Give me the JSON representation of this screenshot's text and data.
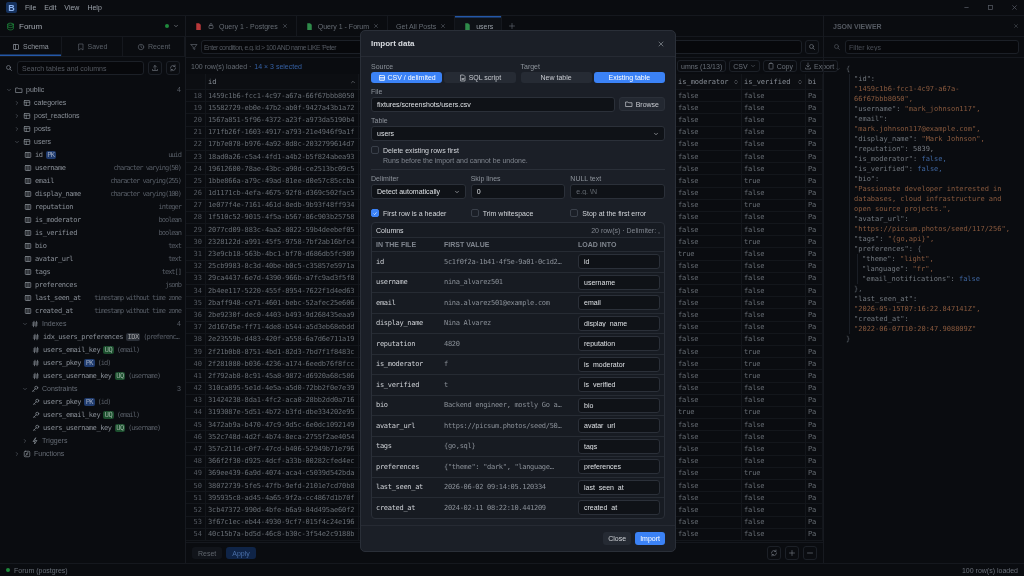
{
  "menubar": {
    "logo": "B",
    "menus": [
      "File",
      "Edit",
      "View",
      "Help"
    ]
  },
  "sidebar": {
    "connection": {
      "name": "Forum",
      "connected": true
    },
    "tabs": [
      {
        "label": "Schema",
        "selected": true
      },
      {
        "label": "Saved",
        "selected": false
      },
      {
        "label": "Recent",
        "selected": false
      }
    ],
    "search": {
      "placeholder": "Search tables and columns"
    },
    "tree": [
      {
        "kind": "schema",
        "label": "public",
        "count": "4",
        "expanded": true,
        "children": [
          {
            "kind": "table",
            "label": "categories",
            "expanded": false
          },
          {
            "kind": "table",
            "label": "post_reactions",
            "expanded": false
          },
          {
            "kind": "table",
            "label": "posts",
            "expanded": false
          },
          {
            "kind": "table",
            "label": "users",
            "expanded": true,
            "children": [
              {
                "kind": "column",
                "label": "id",
                "badge": {
                  "text": "PK",
                  "color": "#1f3b6e"
                },
                "type": "uuid"
              },
              {
                "kind": "column",
                "label": "username",
                "type": "character varying(50)"
              },
              {
                "kind": "column",
                "label": "email",
                "type": "character varying(255)"
              },
              {
                "kind": "column",
                "label": "display_name",
                "type": "character varying(100)"
              },
              {
                "kind": "column",
                "label": "reputation",
                "type": "integer"
              },
              {
                "kind": "column",
                "label": "is_moderator",
                "type": "boolean"
              },
              {
                "kind": "column",
                "label": "is_verified",
                "type": "boolean"
              },
              {
                "kind": "column",
                "label": "bio",
                "type": "text"
              },
              {
                "kind": "column",
                "label": "avatar_url",
                "type": "text"
              },
              {
                "kind": "column",
                "label": "tags",
                "type": "text[]"
              },
              {
                "kind": "column",
                "label": "preferences",
                "type": "jsonb"
              },
              {
                "kind": "column",
                "label": "last_seen_at",
                "type": "timestamp without time zone"
              },
              {
                "kind": "column",
                "label": "created_at",
                "type": "timestamp without time zone"
              },
              {
                "kind": "indexes",
                "label": "Indexes",
                "count": "4",
                "expanded": true,
                "children": [
                  {
                    "kind": "index",
                    "label": "idx_users_preferences",
                    "badge": {
                      "text": "IDX",
                      "color": "#2b3038"
                    },
                    "detail": "(preferenc…"
                  },
                  {
                    "kind": "index",
                    "label": "users_email_key",
                    "badge": {
                      "text": "UQ",
                      "color": "#1c4f2e"
                    },
                    "detail": "(email)"
                  },
                  {
                    "kind": "index",
                    "label": "users_pkey",
                    "badge": {
                      "text": "PK",
                      "color": "#1f3b6e"
                    },
                    "detail": "(id)"
                  },
                  {
                    "kind": "index",
                    "label": "users_username_key",
                    "badge": {
                      "text": "UQ",
                      "color": "#1c4f2e"
                    },
                    "detail": "(username)"
                  }
                ]
              },
              {
                "kind": "constraints",
                "label": "Constraints",
                "count": "3",
                "expanded": true,
                "children": [
                  {
                    "kind": "constraint",
                    "label": "users_pkey",
                    "badge": {
                      "text": "PK",
                      "color": "#1f3b6e"
                    },
                    "detail": "(id)"
                  },
                  {
                    "kind": "constraint",
                    "label": "users_email_key",
                    "badge": {
                      "text": "UQ",
                      "color": "#1c4f2e"
                    },
                    "detail": "(email)"
                  },
                  {
                    "kind": "constraint",
                    "label": "users_username_key",
                    "badge": {
                      "text": "UQ",
                      "color": "#1c4f2e"
                    },
                    "detail": "(username)"
                  }
                ]
              },
              {
                "kind": "triggers",
                "label": "Triggers",
                "expanded": false
              }
            ]
          },
          {
            "kind": "functions",
            "label": "Functions",
            "expanded": false
          }
        ]
      }
    ]
  },
  "editor_tabs": [
    {
      "label": "Query 1 - Postgres",
      "color": "#b8383a",
      "locked": true,
      "selected": false
    },
    {
      "label": "Query 1 - Forum",
      "color": "#2f8a4a",
      "selected": false
    },
    {
      "label": "Get All Posts",
      "selected": false
    },
    {
      "label": "users",
      "color": "#2f8a4a",
      "selected": true
    }
  ],
  "filter": {
    "placeholder": "Enter condition, e.g. id > 100 AND name LIKE 'Peter"
  },
  "result_status": {
    "loaded": "100 row(s) loaded ·",
    "selection": "14 × 3 selected"
  },
  "result_toolbar": [
    {
      "label": "umns (13/13)"
    },
    {
      "label": "CSV",
      "dropdown": true
    },
    {
      "label": "Copy"
    },
    {
      "label": "Export"
    }
  ],
  "table": {
    "columns": [
      {
        "label": "id",
        "sorted": true
      },
      {
        "label": "is_moderator",
        "sorted": false
      },
      {
        "label": "is_verified",
        "sorted": false
      },
      {
        "label": "bi"
      }
    ],
    "rows": [
      {
        "num": "18",
        "cells": [
          "1459c1b6-fcc1-4c97-a67a-66f67bbb8050",
          "false",
          "false",
          "Pa"
        ]
      },
      {
        "num": "19",
        "cells": [
          "15582729-eb0e-47b2-ab0f-9427a43b1a72",
          "false",
          "false",
          "Pa"
        ]
      },
      {
        "num": "20",
        "cells": [
          "1567a851-5f96-4372-a23f-a973da5190b4",
          "false",
          "false",
          "Pa"
        ]
      },
      {
        "num": "21",
        "cells": [
          "171fb26f-1603-4917-a793-21e4946f9a1f",
          "false",
          "false",
          "Pa"
        ]
      },
      {
        "num": "22",
        "cells": [
          "17b7e078-b976-4a92-8d8c-2032799614d7",
          "false",
          "false",
          "Pa"
        ]
      },
      {
        "num": "23",
        "cells": [
          "18ad0a26-c5a4-4fd1-a4b2-b5f824abea93",
          "false",
          "false",
          "Pa"
        ]
      },
      {
        "num": "24",
        "cells": [
          "19612600-78ae-43bc-a90d-ce2513bc09c5",
          "false",
          "false",
          "Pa"
        ]
      },
      {
        "num": "25",
        "cells": [
          "1bbe866a-a79c-49ad-81ee-d0e57c85ccba",
          "false",
          "true",
          "Pa"
        ]
      },
      {
        "num": "26",
        "cells": [
          "1d1171cb-4efa-4675-92f8-d369c502fac5",
          "false",
          "false",
          "Pa"
        ]
      },
      {
        "num": "27",
        "cells": [
          "1e077f4e-7161-461d-8edb-9b93f48ff934",
          "false",
          "true",
          "Pa"
        ]
      },
      {
        "num": "28",
        "cells": [
          "1f510c52-9015-4f5a-b567-86c903b25758",
          "false",
          "false",
          "Pa"
        ]
      },
      {
        "num": "29",
        "cells": [
          "2077cd09-883c-4aa2-8022-59b4deebef05",
          "false",
          "false",
          "Pa"
        ]
      },
      {
        "num": "30",
        "cells": [
          "2328122d-a991-45f5-9758-7bf2ab16bfc4",
          "false",
          "true",
          "Pa"
        ]
      },
      {
        "num": "31",
        "cells": [
          "23e9cb18-563b-4bc1-bf70-d686db5fc989",
          "true",
          "false",
          "Pa"
        ]
      },
      {
        "num": "32",
        "cells": [
          "25cb9983-8c3d-40be-b0c5-c35857e5971a",
          "false",
          "false",
          "Pa"
        ]
      },
      {
        "num": "33",
        "cells": [
          "29ca4437-6e7d-4390-966b-a7fc9ad3f5f8",
          "false",
          "false",
          "Pa"
        ]
      },
      {
        "num": "34",
        "cells": [
          "2b4ee117-5220-455f-8954-7622f1d4ed63",
          "false",
          "false",
          "Pa"
        ]
      },
      {
        "num": "35",
        "cells": [
          "2baff948-ce71-4601-bebc-52afec25e606",
          "false",
          "false",
          "Pa"
        ]
      },
      {
        "num": "36",
        "cells": [
          "2be9230f-dec0-4403-b493-9d268435eaa9",
          "false",
          "false",
          "Pa"
        ]
      },
      {
        "num": "37",
        "cells": [
          "2d167d5e-ff71-4de8-b544-a5d3eb68ebdd",
          "false",
          "false",
          "Pa"
        ]
      },
      {
        "num": "38",
        "cells": [
          "2e23559b-d483-420f-a558-6a7d6e711a19",
          "false",
          "false",
          "Pa"
        ]
      },
      {
        "num": "39",
        "cells": [
          "2f21b0b8-8751-4bd1-82d3-7bd7f1f8483c",
          "false",
          "true",
          "Pa"
        ]
      },
      {
        "num": "40",
        "cells": [
          "2f281080-b036-4236-a174-6eedb76f8fcc",
          "false",
          "true",
          "Pa"
        ]
      },
      {
        "num": "41",
        "cells": [
          "2f792ab8-8c91-45a8-9872-d6920a68c586",
          "false",
          "true",
          "Pa"
        ]
      },
      {
        "num": "42",
        "cells": [
          "310ca895-5e1d-4e5a-a5d0-72bb2f0e7e39",
          "false",
          "false",
          "Pa"
        ]
      },
      {
        "num": "43",
        "cells": [
          "31424238-8da1-4fc2-aca0-28bb2dd0a716",
          "false",
          "false",
          "Pa"
        ]
      },
      {
        "num": "44",
        "cells": [
          "3193087e-5d51-4b72-b3fd-dbe334202e95",
          "true",
          "true",
          "Pa"
        ]
      },
      {
        "num": "45",
        "cells": [
          "3472ab9a-b470-47c9-9d5c-6e0dc1092149",
          "false",
          "false",
          "Pa"
        ]
      },
      {
        "num": "46",
        "cells": [
          "352c748d-4d2f-4b74-8eca-2755f2ae4054",
          "false",
          "false",
          "Pa"
        ]
      },
      {
        "num": "47",
        "cells": [
          "357c211d-c0f7-47cd-b406-52949b71e796",
          "false",
          "false",
          "Pa"
        ]
      },
      {
        "num": "48",
        "cells": [
          "366f2f30-d925-4dcf-a33b-00282cfed4ec",
          "false",
          "false",
          "Pa"
        ]
      },
      {
        "num": "49",
        "cells": [
          "369ee439-6a9d-4074-aca4-c5039d542bda",
          "false",
          "true",
          "Pa"
        ]
      },
      {
        "num": "50",
        "cells": [
          "38072739-5fe5-47fb-9efd-2101e7cd70b8",
          "false",
          "false",
          "Pa"
        ]
      },
      {
        "num": "51",
        "cells": [
          "395935c8-ad45-4a65-9f2a-cc4867d1b70f",
          "false",
          "false",
          "Pa"
        ]
      },
      {
        "num": "52",
        "cells": [
          "3cb47372-990d-4bfe-b6a9-84d495ae60f2",
          "false",
          "false",
          "Pa"
        ]
      },
      {
        "num": "53",
        "cells": [
          "3f67c1ec-eb44-4930-9cf7-015f4c24e196",
          "false",
          "false",
          "Pa"
        ]
      },
      {
        "num": "54",
        "cells": [
          "40c15b7a-bd5d-46c8-b30c-3f54e2c9188b",
          "false",
          "false",
          "Pa"
        ]
      }
    ]
  },
  "bottom_bar": {
    "buttons": [
      {
        "label": "Reset",
        "primary": false
      },
      {
        "label": "Apply",
        "primary": true
      }
    ]
  },
  "json_viewer": {
    "title": "JSON VIEWER",
    "filter_placeholder": "Filter keys",
    "document": {
      "open": "{",
      "close": "}",
      "expanded": true,
      "children": [
        {
          "key": "\"id\":",
          "value": "\"1459c1b6-fcc1-4c97-a67a-66f67bbb8050\",",
          "kind": "string"
        },
        {
          "key": "\"username\":",
          "value": "\"mark_johnson117\",",
          "kind": "string"
        },
        {
          "key": "\"email\":",
          "value": "\"mark.johnson117@example.com\",",
          "kind": "string"
        },
        {
          "key": "\"display_name\":",
          "value": "\"Mark Johnson\",",
          "kind": "string"
        },
        {
          "key": "\"reputation\":",
          "value": "5839,",
          "kind": "number"
        },
        {
          "key": "\"is_moderator\":",
          "value": "false,",
          "kind": "boolean"
        },
        {
          "key": "\"is_verified\":",
          "value": "false,",
          "kind": "boolean"
        },
        {
          "key": "\"bio\":",
          "value": "\"Passionate developer interested in databases, cloud infrastructure and open source projects.\",",
          "kind": "string"
        },
        {
          "key": "\"avatar_url\":",
          "value": "\"https://picsum.photos/seed/117/256\",",
          "kind": "string"
        },
        {
          "key": "\"tags\":",
          "value": "\"{go,api}\",",
          "kind": "string"
        },
        {
          "key": "\"preferences\":",
          "open": "{",
          "close": "},",
          "children": [
            {
              "key": "\"theme\":",
              "value": "\"light\",",
              "kind": "string"
            },
            {
              "key": "\"language\":",
              "value": "\"fr\",",
              "kind": "string"
            },
            {
              "key": "\"email_notifications\":",
              "value": "false",
              "kind": "boolean"
            }
          ]
        },
        {
          "key": "\"last_seen_at\":",
          "value": "\"2026-05-15T07:16:22.847141Z\",",
          "kind": "string"
        },
        {
          "key": "\"created_at\":",
          "value": "\"2022-06-07T10:20:47.908809Z\"",
          "kind": "string"
        }
      ]
    }
  },
  "status_bar": {
    "connection": "Forum (postgres)",
    "connected": true,
    "rows": "100 row(s) loaded"
  },
  "dialog": {
    "title": "Import data",
    "source": {
      "label": "Source",
      "options": [
        {
          "label": "CSV / delimited",
          "selected": true
        },
        {
          "label": "SQL script",
          "selected": false
        }
      ]
    },
    "target": {
      "label": "Target",
      "options": [
        {
          "label": "New table",
          "selected": false
        },
        {
          "label": "Existing table",
          "selected": true
        }
      ]
    },
    "file": {
      "label": "File",
      "value": "fixtures/screenshots/users.csv",
      "browse": "Browse"
    },
    "table": {
      "label": "Table",
      "value": "users"
    },
    "delete_rows": {
      "label": "Delete existing rows first",
      "checked": false,
      "hint": "Runs before the import and cannot be undone."
    },
    "delimiter": {
      "label": "Delimiter",
      "value": "Detect automatically"
    },
    "skip_lines": {
      "label": "Skip lines",
      "value": "0"
    },
    "null_text": {
      "label": "NULL text",
      "placeholder": "e.g. \\N"
    },
    "options": [
      {
        "label": "First row is a header",
        "checked": true
      },
      {
        "label": "Trim whitespace",
        "checked": false
      },
      {
        "label": "Stop at the first error",
        "checked": false
      }
    ],
    "columns": {
      "title": "Columns",
      "summary": "20 row(s) · Delimiter: ,",
      "headers": [
        "IN THE FILE",
        "FIRST VALUE",
        "LOAD INTO"
      ],
      "rows": [
        {
          "name": "id",
          "first_value": "5c1f0f2a-1b41-4f5e-9a01-0c1d2…",
          "load_into": "id"
        },
        {
          "name": "username",
          "first_value": "nina_alvarez501",
          "load_into": "username"
        },
        {
          "name": "email",
          "first_value": "nina.alvarez501@example.com",
          "load_into": "email"
        },
        {
          "name": "display_name",
          "first_value": "Nina Alvarez",
          "load_into": "display_name"
        },
        {
          "name": "reputation",
          "first_value": "4820",
          "load_into": "reputation"
        },
        {
          "name": "is_moderator",
          "first_value": "f",
          "load_into": "is_moderator"
        },
        {
          "name": "is_verified",
          "first_value": "t",
          "load_into": "is_verified"
        },
        {
          "name": "bio",
          "first_value": "Backend engineer, mostly Go a…",
          "load_into": "bio"
        },
        {
          "name": "avatar_url",
          "first_value": "https://picsum.photos/seed/50…",
          "load_into": "avatar_url"
        },
        {
          "name": "tags",
          "first_value": "{go,sql}",
          "load_into": "tags"
        },
        {
          "name": "preferences",
          "first_value": "{\"theme\": \"dark\", \"language…",
          "load_into": "preferences"
        },
        {
          "name": "last_seen_at",
          "first_value": "2026-06-02 09:14:05.120334",
          "load_into": "last_seen_at"
        },
        {
          "name": "created_at",
          "first_value": "2024-02-11 08:22:10.441209",
          "load_into": "created_at"
        }
      ]
    },
    "buttons": [
      {
        "label": "Close",
        "primary": false
      },
      {
        "label": "Import",
        "primary": true
      }
    ]
  }
}
